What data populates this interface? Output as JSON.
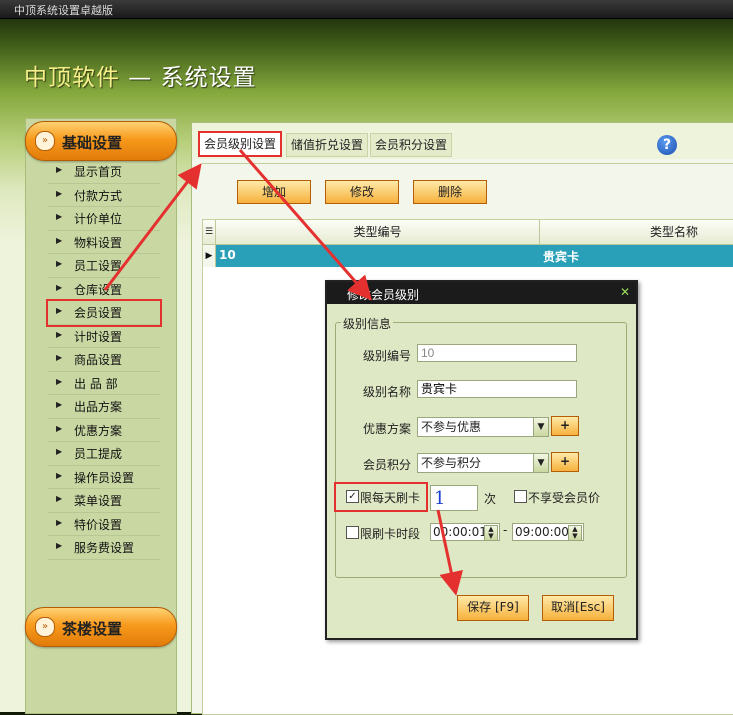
{
  "window": {
    "title": "中顶系统设置卓越版"
  },
  "header": {
    "title_prefix": "中顶软件",
    "title_suffix": " — 系统设置"
  },
  "sidebar": {
    "category_basic": "基础设置",
    "category_teahouse": "茶楼设置",
    "items": [
      {
        "label": "显示首页"
      },
      {
        "label": "付款方式"
      },
      {
        "label": "计价单位"
      },
      {
        "label": "物料设置"
      },
      {
        "label": "员工设置"
      },
      {
        "label": "仓库设置"
      },
      {
        "label": "会员设置",
        "selected": true
      },
      {
        "label": "计时设置"
      },
      {
        "label": "商品设置"
      },
      {
        "label": "出 品 部"
      },
      {
        "label": "出品方案"
      },
      {
        "label": "优惠方案"
      },
      {
        "label": "员工提成"
      },
      {
        "label": "操作员设置"
      },
      {
        "label": "菜单设置"
      },
      {
        "label": "特价设置"
      },
      {
        "label": "服务费设置"
      }
    ]
  },
  "tabs": [
    {
      "label": "会员级别设置",
      "active": true
    },
    {
      "label": "储值折兑设置"
    },
    {
      "label": "会员积分设置"
    }
  ],
  "toolbar": {
    "add": "增加",
    "edit": "修改",
    "delete": "删除"
  },
  "table": {
    "columns": [
      "类型编号",
      "类型名称"
    ],
    "rows": [
      {
        "code": "10",
        "name": "贵宾卡"
      }
    ]
  },
  "dialog": {
    "title": "修改会员级别",
    "legend": "级别信息",
    "code_label": "级别编号",
    "code_value": "10",
    "name_label": "级别名称",
    "name_value": "贵宾卡",
    "discount_label": "优惠方案",
    "discount_value": "不参与优惠",
    "points_label": "会员积分",
    "points_value": "不参与积分",
    "limit_daily_label": "限每天刷卡",
    "limit_daily_checked": true,
    "limit_daily_times": "1",
    "times_unit": "次",
    "no_member_price_label": "不享受会员价",
    "no_member_price_checked": false,
    "limit_time_label": "限刷卡时段",
    "limit_time_checked": false,
    "time_start": "00:00:01",
    "time_separator": "-",
    "time_end": "09:00:00",
    "save_label": "保存 [F9]",
    "cancel_label": "取消[Esc]",
    "close_icon": "close-icon"
  },
  "colors": {
    "accent_orange": "#f79a1c",
    "highlight_red": "#e53030",
    "row_selected": "#2a9fb8"
  }
}
